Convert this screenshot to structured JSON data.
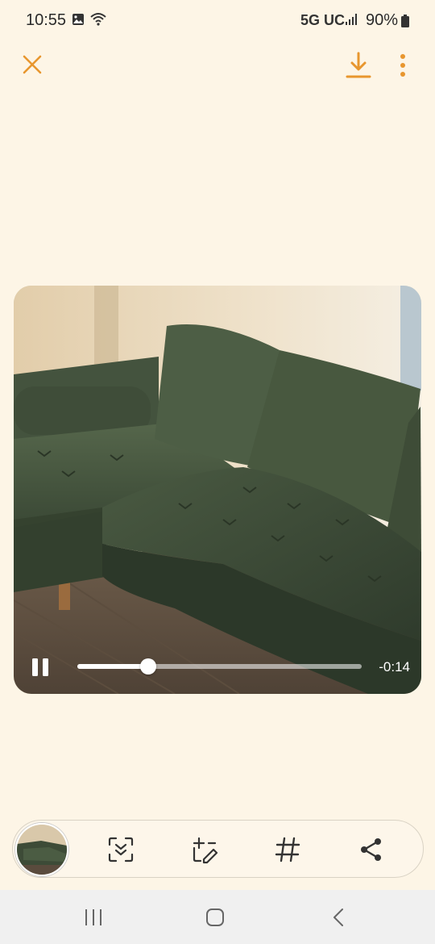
{
  "status_bar": {
    "time": "10:55",
    "network": "5G UC",
    "battery": "90%",
    "icons": [
      "gallery-notification-icon",
      "wifi-icon",
      "signal-icon",
      "battery-icon"
    ]
  },
  "top_bar": {
    "icons": [
      "close-icon",
      "download-icon",
      "more-options-icon"
    ],
    "accent_color": "#e8962e"
  },
  "video": {
    "remaining_time": "-0:14",
    "progress": 0.25,
    "state": "playing",
    "icons": [
      "pause-icon"
    ]
  },
  "action_bar": {
    "icons": [
      "scan-icon",
      "edit-icon",
      "tag-icon",
      "share-icon"
    ]
  },
  "nav_bar": {
    "icons": [
      "recent-apps-icon",
      "home-icon",
      "back-icon"
    ]
  },
  "colors": {
    "background": "#fdf5e6",
    "accent": "#e8962e"
  }
}
